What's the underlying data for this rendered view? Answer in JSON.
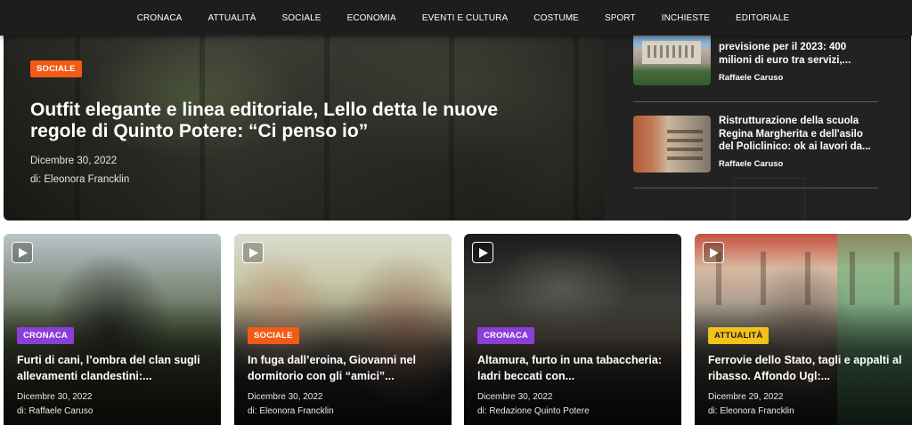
{
  "nav": {
    "items": [
      "CRONACA",
      "ATTUALITÀ",
      "SOCIALE",
      "ECONOMIA",
      "EVENTI E CULTURA",
      "COSTUME",
      "SPORT",
      "INCHIESTE",
      "EDITORIALE"
    ]
  },
  "hero": {
    "category": "SOCIALE",
    "title": "Outfit elegante e linea editoriale, Lello detta le nuove regole di Quinto Potere: “Ci penso io”",
    "date": "Dicembre 30, 2022",
    "author": "di: Eleonora Francklin"
  },
  "sidebar": {
    "items": [
      {
        "title": "previsione per il 2023: 400 milioni di euro tra servizi,...",
        "author": "Raffaele Caruso"
      },
      {
        "title": "Ristrutturazione della scuola Regina Margherita e dell'asilo del Policlinico: ok ai lavori da...",
        "author": "Raffaele Caruso"
      }
    ]
  },
  "cards": [
    {
      "category": "CRONACA",
      "category_color": "#8b3fd9",
      "title": "Furti di cani, l’ombra del clan sugli allevamenti clandestini:...",
      "date": "Dicembre 30, 2022",
      "author": "di: Raffaele Caruso",
      "icon": "play-icon"
    },
    {
      "category": "SOCIALE",
      "category_color": "#f25a16",
      "title": "In fuga dall’eroina, Giovanni nel dormitorio con gli “amici”...",
      "date": "Dicembre 30, 2022",
      "author": "di: Eleonora Francklin",
      "icon": "play-icon"
    },
    {
      "category": "CRONACA",
      "category_color": "#8b3fd9",
      "title": "Altamura, furto in una tabaccheria: ladri beccati con...",
      "date": "Dicembre 30, 2022",
      "author": "di: Redazione Quinto Potere",
      "icon": "play-icon"
    },
    {
      "category": "ATTUALITÀ",
      "category_color": "#f3c21b",
      "title": "Ferrovie dello Stato, tagli e appalti al ribasso. Affondo Ugl:...",
      "date": "Dicembre 29, 2022",
      "author": "di: Eleonora Francklin",
      "icon": "play-icon"
    }
  ],
  "colors": {
    "nav_bg": "#1d1d1d",
    "orange": "#f25a16",
    "purple": "#8b3fd9",
    "yellow": "#f3c21b"
  }
}
